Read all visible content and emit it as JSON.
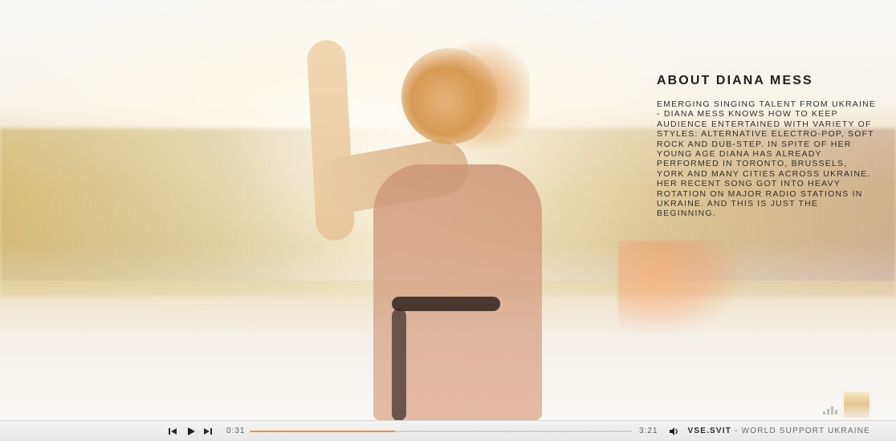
{
  "about": {
    "title": "ABOUT DIANA MESS",
    "body": "EMERGING SINGING TALENT FROM UKRAINE - DIANA MESS KNOWS HOW TO KEEP AUDIENCE ENTERTAINED WITH VARIETY OF STYLES: ALTERNATIVE ELECTRO-POP, SOFT ROCK AND DUB-STEP. IN SPITE OF HER YOUNG AGE DIANA HAS ALREADY PERFORMED IN TORONTO, BRUSSELS, YORK AND MANY CITIES ACROSS UKRAINE. HER RECENT SONG GOT INTO HEAVY ROTATION ON MAJOR RADIO STATIONS IN UKRAINE. AND THIS IS JUST THE BEGINNING."
  },
  "player": {
    "current_time": "0:31",
    "total_time": "3:21",
    "progress_fraction": 0.38,
    "colors": {
      "progress_accent": "#f1903b"
    },
    "icons": {
      "prev": "previous-icon",
      "play": "play-icon",
      "next": "next-icon",
      "volume": "volume-icon"
    }
  },
  "brand": {
    "name": "VSE.SVIT",
    "separator": " - ",
    "tagline": "WORLD SUPPORT UKRAINE"
  },
  "thumbnail": {
    "icon": "gallery-thumbnail-icon"
  },
  "levels_icon": "audio-levels-icon"
}
